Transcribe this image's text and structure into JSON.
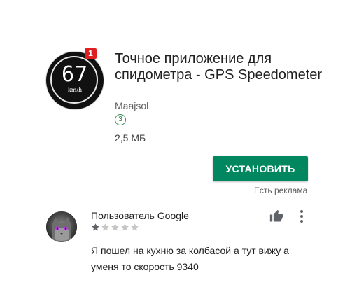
{
  "app": {
    "icon": {
      "speed": "67",
      "unit": "km/h"
    },
    "notification_badge": "1",
    "title": "Точное приложение для спидометра - GPS Speedometer",
    "developer": "Maajsol",
    "age_rating": "3",
    "size": "2,5 МБ",
    "install_label": "УСТАНОВИТЬ",
    "ad_label": "Есть реклама"
  },
  "review": {
    "reviewer_name": "Пользователь Google",
    "rating": 1,
    "rating_max": 5,
    "text": "Я пошел на кухню за колбасой а тут вижу а уменя то скорость 9340"
  },
  "colors": {
    "install_button": "#01875f",
    "badge_red": "#e02020",
    "age_badge_green": "#2e8b57",
    "star_filled": "#5f6368",
    "star_empty": "#c6c6c6"
  },
  "icons": {
    "thumb": "thumbs-up-icon",
    "more": "more-vertical-icon"
  }
}
